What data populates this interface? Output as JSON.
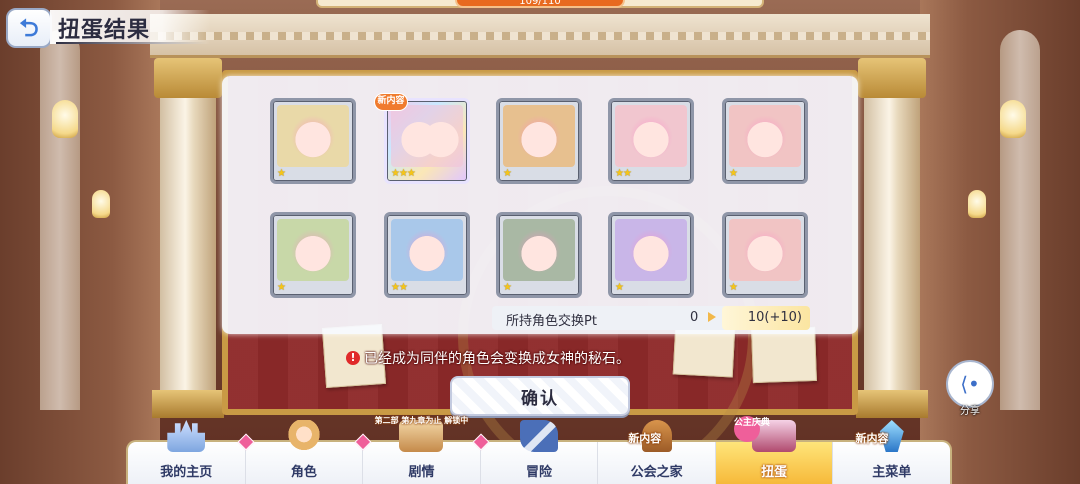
{
  "header": {
    "title": "扭蛋结果",
    "counter": "109/110"
  },
  "results": {
    "new_badge": "新内容",
    "cards": [
      {
        "stars": "★",
        "color": "#e9d9a8"
      },
      {
        "stars": "★★★",
        "color": "#f2c3d8"
      },
      {
        "stars": "★",
        "color": "#e7c08f"
      },
      {
        "stars": "★★",
        "color": "#f1c6cf"
      },
      {
        "stars": "★",
        "color": "#f1c4c4"
      },
      {
        "stars": "★",
        "color": "#c8d8a8"
      },
      {
        "stars": "★★",
        "color": "#a9c8ea"
      },
      {
        "stars": "★",
        "color": "#a9b8a4"
      },
      {
        "stars": "★",
        "color": "#c9b6e8"
      },
      {
        "stars": "★",
        "color": "#f1c4c4"
      }
    ],
    "pt_label": "所持角色交换Pt",
    "pt_current": "0",
    "pt_result": "10(+10)",
    "notice": "已经成为同伴的角色会变换成女神的秘石。",
    "confirm_label": "确认"
  },
  "share": {
    "label": "分享",
    "icon": "share-icon"
  },
  "nav": {
    "items": [
      {
        "label": "我的主页",
        "icon": "castle-icon"
      },
      {
        "label": "角色",
        "icon": "character-icon"
      },
      {
        "label": "剧情",
        "icon": "book-icon",
        "tag": "第二部 第九章为止 解锁中"
      },
      {
        "label": "冒险",
        "icon": "sword-icon"
      },
      {
        "label": "公会之家",
        "icon": "door-icon",
        "tag": "新内容"
      },
      {
        "label": "扭蛋",
        "icon": "gacha-icon",
        "tag": "公主庆典",
        "active": true
      },
      {
        "label": "主菜单",
        "icon": "crystal-icon",
        "tag": "新内容"
      }
    ]
  },
  "colors": {
    "accent_orange": "#e86a1f",
    "nav_text": "#2f3a66",
    "notice_red": "#e02a2a"
  }
}
